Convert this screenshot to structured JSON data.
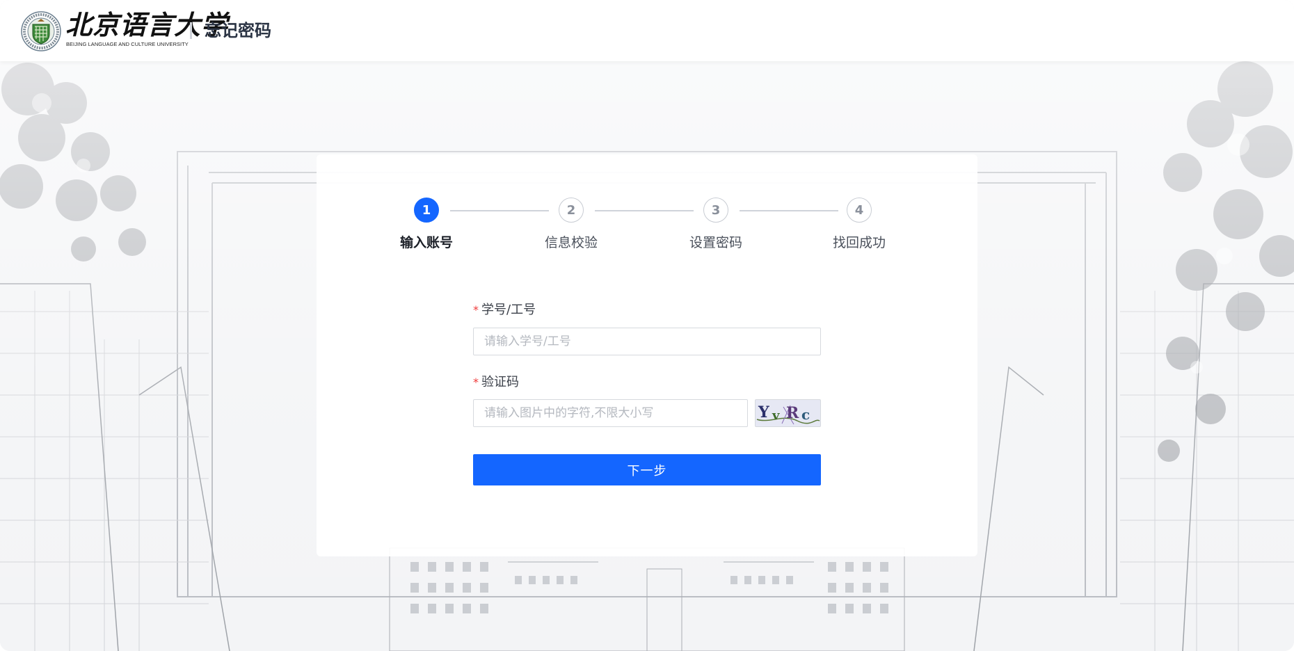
{
  "header": {
    "logo_cn": "北京语言大学",
    "logo_en": "BEIJING LANGUAGE AND CULTURE UNIVERSITY",
    "title": "忘记密码"
  },
  "steps": [
    {
      "number": "1",
      "label": "输入账号",
      "active": true
    },
    {
      "number": "2",
      "label": "信息校验",
      "active": false
    },
    {
      "number": "3",
      "label": "设置密码",
      "active": false
    },
    {
      "number": "4",
      "label": "找回成功",
      "active": false
    }
  ],
  "form": {
    "account": {
      "required_mark": "*",
      "label": "学号/工号",
      "placeholder": "请输入学号/工号",
      "value": ""
    },
    "captcha": {
      "required_mark": "*",
      "label": "验证码",
      "placeholder": "请输入图片中的字符,不限大小写",
      "value": "",
      "image_text": "YvRc"
    },
    "submit_label": "下一步"
  },
  "colors": {
    "accent": "#1466ff",
    "required": "#f03b3b",
    "header_title": "#2b3444"
  }
}
